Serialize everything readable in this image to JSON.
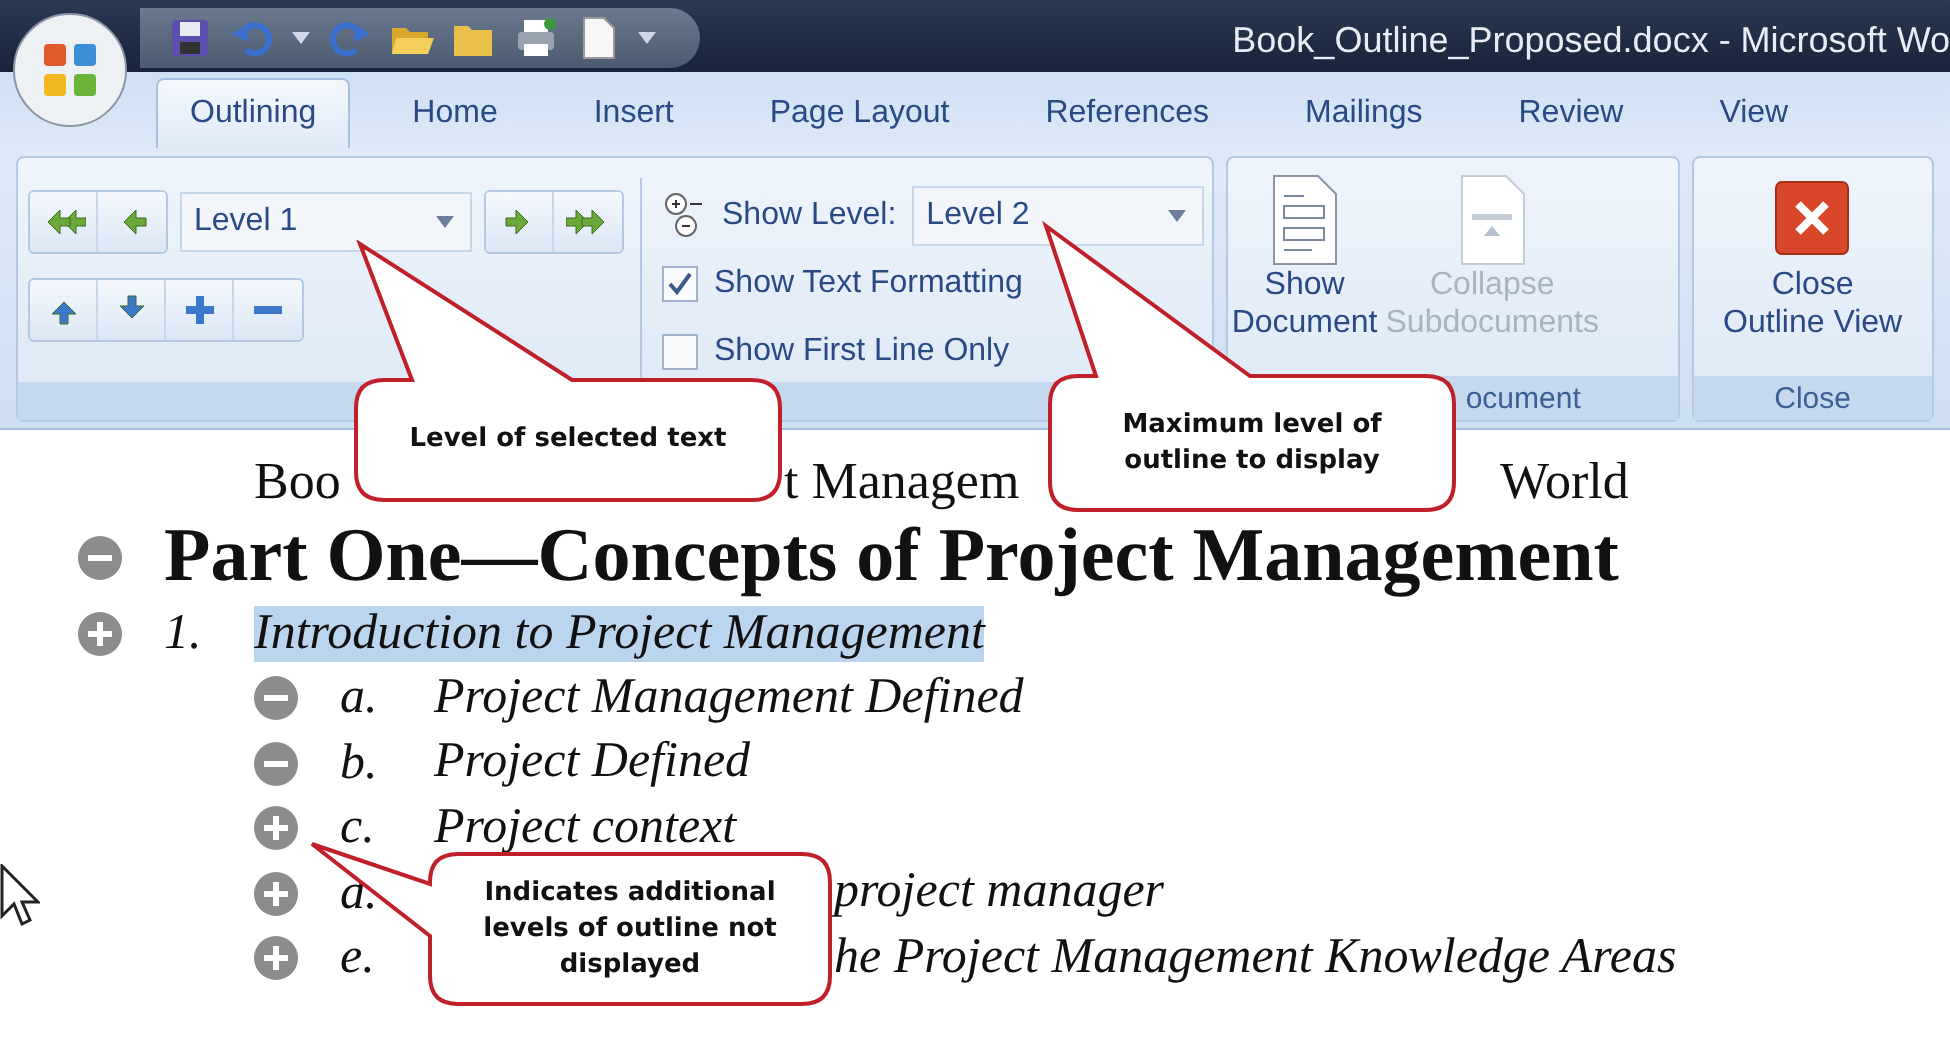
{
  "window": {
    "title": "Book_Outline_Proposed.docx - Microsoft Wo"
  },
  "tabs": [
    {
      "label": "Outlining",
      "selected": true
    },
    {
      "label": "Home",
      "selected": false
    },
    {
      "label": "Insert",
      "selected": false
    },
    {
      "label": "Page Layout",
      "selected": false
    },
    {
      "label": "References",
      "selected": false
    },
    {
      "label": "Mailings",
      "selected": false
    },
    {
      "label": "Review",
      "selected": false
    },
    {
      "label": "View",
      "selected": false
    }
  ],
  "ribbon": {
    "outline_tools": {
      "level_of_selection": "Level 1",
      "show_level": {
        "label": "Show Level:",
        "value": "Level 2"
      },
      "options": [
        {
          "label": "Show Text Formatting",
          "checked": true
        },
        {
          "label": "Show First Line Only",
          "checked": false
        }
      ]
    },
    "master_document": {
      "buttons": [
        {
          "label": "Show Document",
          "disabled": false
        },
        {
          "label": "Collapse Subdocuments",
          "disabled": true
        }
      ],
      "group_label": "ocument"
    },
    "close": {
      "button": "Close Outline View",
      "group_label": "Close"
    }
  },
  "document": {
    "title_fragments": [
      "Boo",
      "t Managem",
      "World"
    ],
    "outline": [
      {
        "kind": "heading",
        "text": "Part One—Concepts of Project Management",
        "has_subtext": false,
        "selected": false
      },
      {
        "kind": "chapter",
        "number": "1.",
        "text": "Introduction to Project Management",
        "has_subtext": true,
        "selected": true,
        "children": [
          {
            "number": "a.",
            "text": "Project Management Defined",
            "has_subtext": false
          },
          {
            "number": "b.",
            "text": "Project  Defined",
            "has_subtext": false
          },
          {
            "number": "c.",
            "text": "Project context",
            "has_subtext": true
          },
          {
            "number": "d.",
            "text": "project manager",
            "has_subtext": true
          },
          {
            "number": "e.",
            "text": "he Project Management Knowledge Areas",
            "has_subtext": true
          }
        ]
      }
    ]
  },
  "callouts": [
    {
      "text": "Level of selected text"
    },
    {
      "text": "Maximum level of outline to display"
    },
    {
      "text": "Indicates additional levels of outline not displayed"
    }
  ]
}
